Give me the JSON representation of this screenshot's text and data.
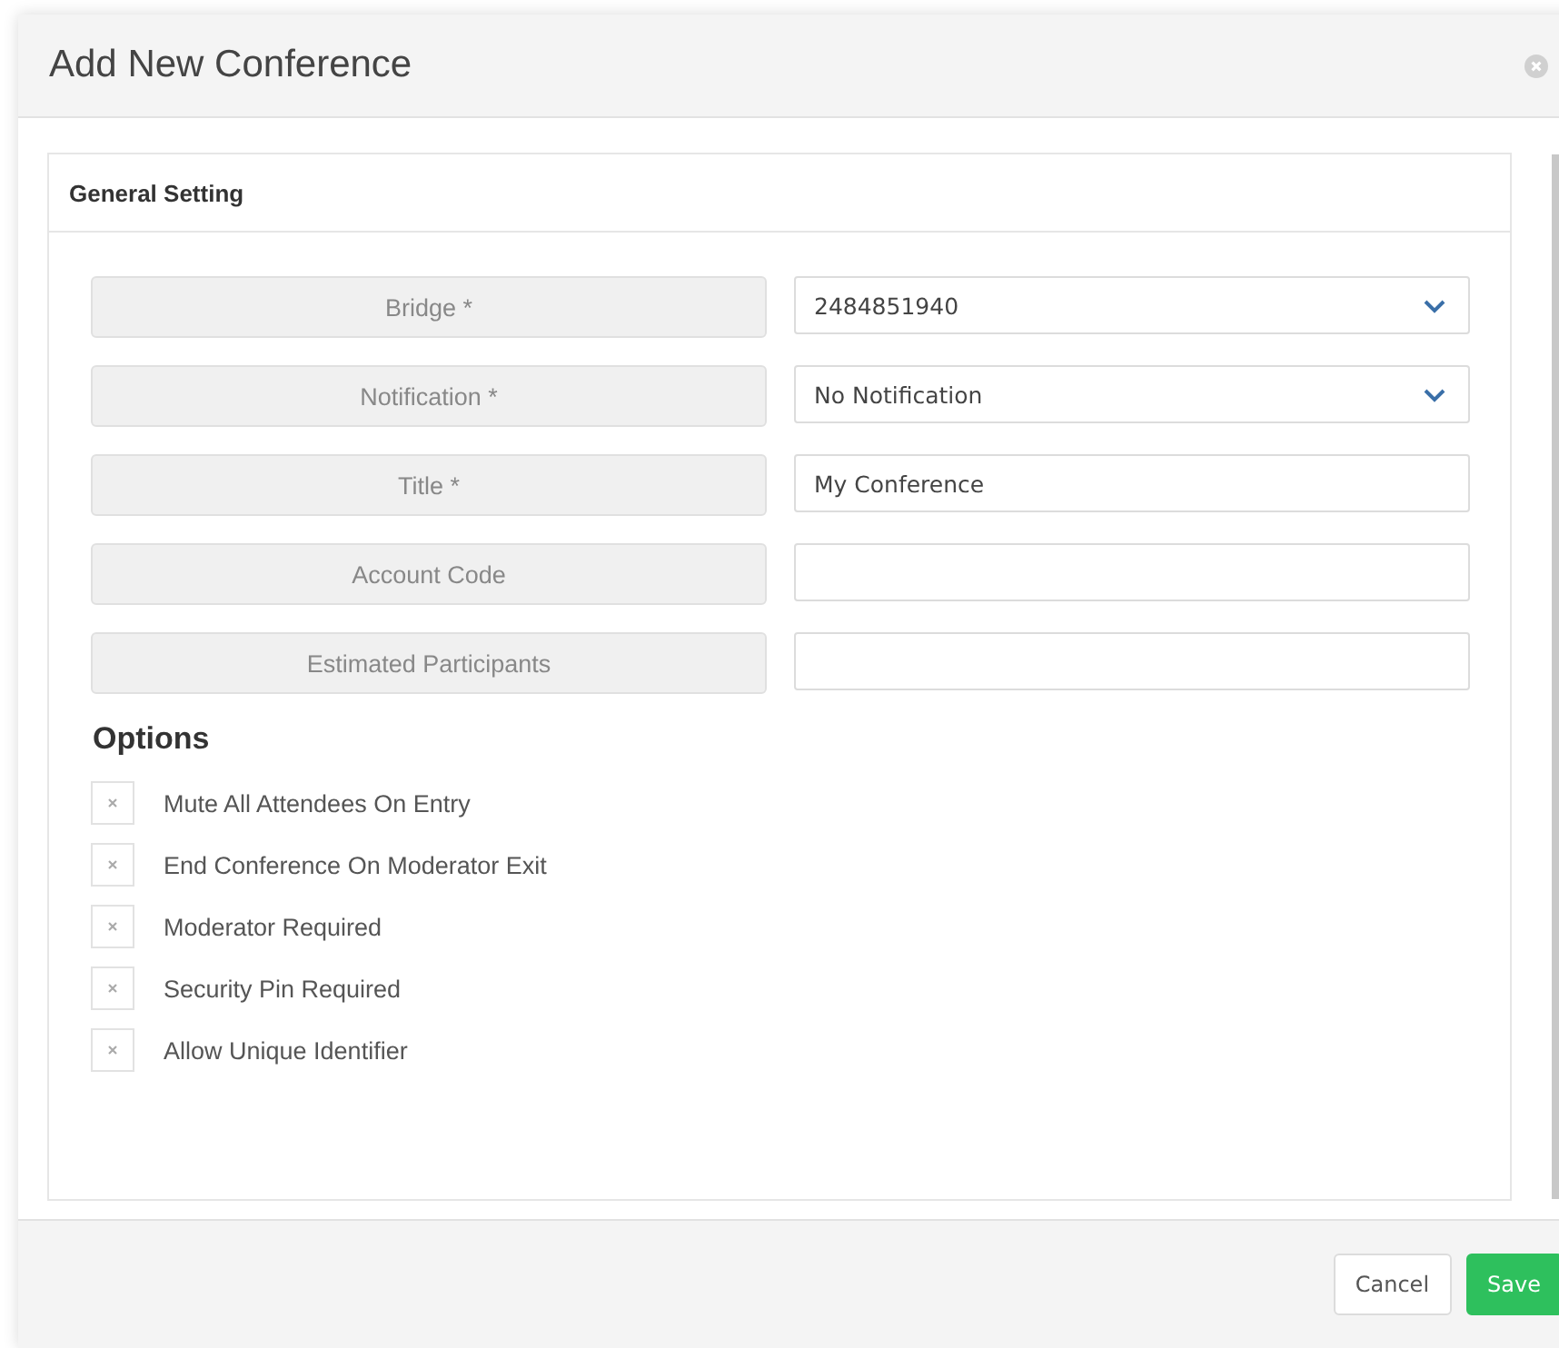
{
  "dialog": {
    "title": "Add New Conference"
  },
  "panel": {
    "heading": "General Setting"
  },
  "fields": [
    {
      "label": "Bridge *",
      "kind": "select",
      "value": "2484851940"
    },
    {
      "label": "Notification *",
      "kind": "select",
      "value": "No Notification"
    },
    {
      "label": "Title *",
      "kind": "text",
      "value": "My Conference"
    },
    {
      "label": "Account Code",
      "kind": "text"
    },
    {
      "label": "Estimated Participants",
      "kind": "text"
    }
  ],
  "options": {
    "heading": "Options",
    "items": [
      {
        "label": "Mute All Attendees On Entry",
        "checked": false
      },
      {
        "label": "End Conference On Moderator Exit",
        "checked": false
      },
      {
        "label": "Moderator Required",
        "checked": false
      },
      {
        "label": "Security Pin Required",
        "checked": false
      },
      {
        "label": "Allow Unique Identifier",
        "checked": false
      }
    ]
  },
  "buttons": [
    {
      "label": "Cancel",
      "kind": "secondary"
    },
    {
      "label": "Save",
      "kind": "primary"
    }
  ]
}
